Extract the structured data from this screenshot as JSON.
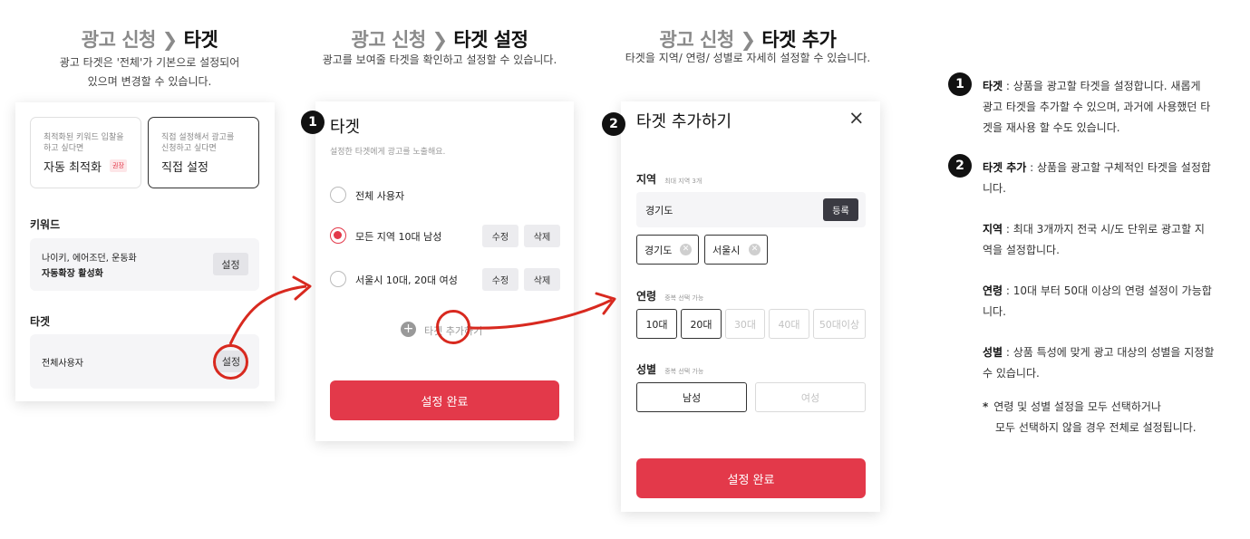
{
  "panel1": {
    "heading_pre": "광고 신청 ❯ ",
    "heading_post": "타겟",
    "sub_line1": "광고 타겟은 '전체'가 기본으로 설정되어",
    "sub_line2": "있으며 변경할 수 있습니다.",
    "option_auto": {
      "desc_line1": "최적화된 키워드 입찰을",
      "desc_line2": "하고 싶다면",
      "label": "자동 최적화",
      "badge": "권장"
    },
    "option_manual": {
      "desc_line1": "직접 설정해서 광고를",
      "desc_line2": "신청하고 싶다면",
      "label": "직접 설정"
    },
    "keyword_title": "키워드",
    "keyword_line1": "나이키, 에어조던, 운동화",
    "keyword_line2": "자동확장 활성화",
    "keyword_button": "설정",
    "target_title": "타겟",
    "target_value": "전체사용자",
    "target_button": "설정"
  },
  "panel2": {
    "heading_pre": "광고 신청 ❯ ",
    "heading_post": "타겟 설정",
    "sub": "광고를 보여줄 타겟을 확인하고 설정할 수 있습니다.",
    "badge": "1",
    "title": "타겟",
    "hint": "설정한 타겟에게 광고를 노출해요.",
    "options": [
      {
        "label": "전체 사용자",
        "selected": false
      },
      {
        "label": "모든 지역 10대 남성",
        "selected": true,
        "edit": "수정",
        "delete": "삭제"
      },
      {
        "label": "서울시 10대, 20대 여성",
        "selected": false,
        "edit": "수정",
        "delete": "삭제"
      }
    ],
    "add_label": "타겟 추가하기",
    "done": "설정 완료"
  },
  "panel3": {
    "heading_pre": "광고 신청 ❯ ",
    "heading_post": "타겟 추가",
    "sub": "타겟을 지역/ 연령/ 성별로 자세히 설정할 수 있습니다.",
    "badge": "2",
    "title": "타겟 추가하기",
    "close": "×",
    "region_title": "지역",
    "region_hint": "최대 지역 3개",
    "region_input": "경기도",
    "register": "등록",
    "region_tags": [
      "경기도",
      "서울시"
    ],
    "age_title": "연령",
    "age_hint": "중복 선택 가능",
    "ages": [
      {
        "label": "10대",
        "selected": true
      },
      {
        "label": "20대",
        "selected": true
      },
      {
        "label": "30대",
        "selected": false
      },
      {
        "label": "40대",
        "selected": false
      },
      {
        "label": "50대이상",
        "selected": false
      }
    ],
    "gender_title": "성별",
    "gender_hint": "중복 선택 가능",
    "genders": [
      {
        "label": "남성",
        "selected": true
      },
      {
        "label": "여성",
        "selected": false
      }
    ],
    "done": "설정 완료"
  },
  "notes": {
    "n1_badge": "1",
    "n1_title": "타겟",
    "n1_line1": " : 상품을 광고할 타겟을 설정합니다. 새롭게",
    "n1_line2": "광고 타겟을 추가할 수 있으며, 과거에 사용했던 타",
    "n1_line3": "겟을 재사용 할 수도 있습니다.",
    "n2_badge": "2",
    "n2_title": "타겟 추가",
    "n2_line1": " : 상품을 광고할 구체적인 타겟을 설정합",
    "n2_line2": "니다.",
    "region_title": "지역",
    "region_line1": " : 최대 3개까지 전국 시/도 단위로 광고할 지",
    "region_line2": "역을 설정합니다.",
    "age_title": "연령",
    "age_line1": " : 10대 부터 50대 이상의 연령 설정이 가능합",
    "age_line2": "니다.",
    "gender_title": "성별",
    "gender_line1": " : 상품 특성에 맞게 광고 대상의 성별을 지정할",
    "gender_line2": "수 있습니다.",
    "star": "*",
    "foot_line1": "연령 및 성별 설정을 모두 선택하거나",
    "foot_line2": "모두 선택하지 않을 경우 전체로 설정됩니다."
  },
  "colors": {
    "accent": "#e3394a",
    "annotation": "#d8291f",
    "dark": "#111111"
  }
}
